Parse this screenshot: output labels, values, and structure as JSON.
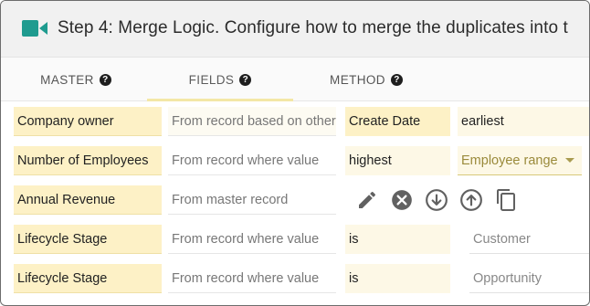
{
  "header": {
    "title": "Step 4: Merge Logic. Configure how to merge the duplicates into t",
    "icon": "video-camera-icon",
    "accent": "#1f9b8f"
  },
  "tabs": [
    {
      "label": "MASTER",
      "help": "?"
    },
    {
      "label": "FIELDS",
      "help": "?"
    },
    {
      "label": "METHOD",
      "help": "?"
    }
  ],
  "rows": [
    {
      "label": "Company owner",
      "source": "From record based on other",
      "operator": "Create Date",
      "value": "earliest"
    },
    {
      "label": "Number of Employees",
      "source": "From record where value",
      "operator": "highest",
      "value": "Employee range"
    },
    {
      "label": "Annual Revenue",
      "source": "From master record",
      "icons": [
        "edit-icon",
        "remove-icon",
        "move-down-icon",
        "move-up-icon",
        "copy-icon"
      ]
    },
    {
      "label": "Lifecycle Stage",
      "source": "From record where value",
      "operator": "is",
      "value": "Customer"
    },
    {
      "label": "Lifecycle Stage",
      "source": "From record where value",
      "operator": "is",
      "value": "Opportunity"
    }
  ],
  "colors": {
    "highlight": "#fdf1c6",
    "pale_highlight": "#fdf8e6",
    "tab_underline": "#f3e7a6",
    "icon_gray": "#616161"
  }
}
